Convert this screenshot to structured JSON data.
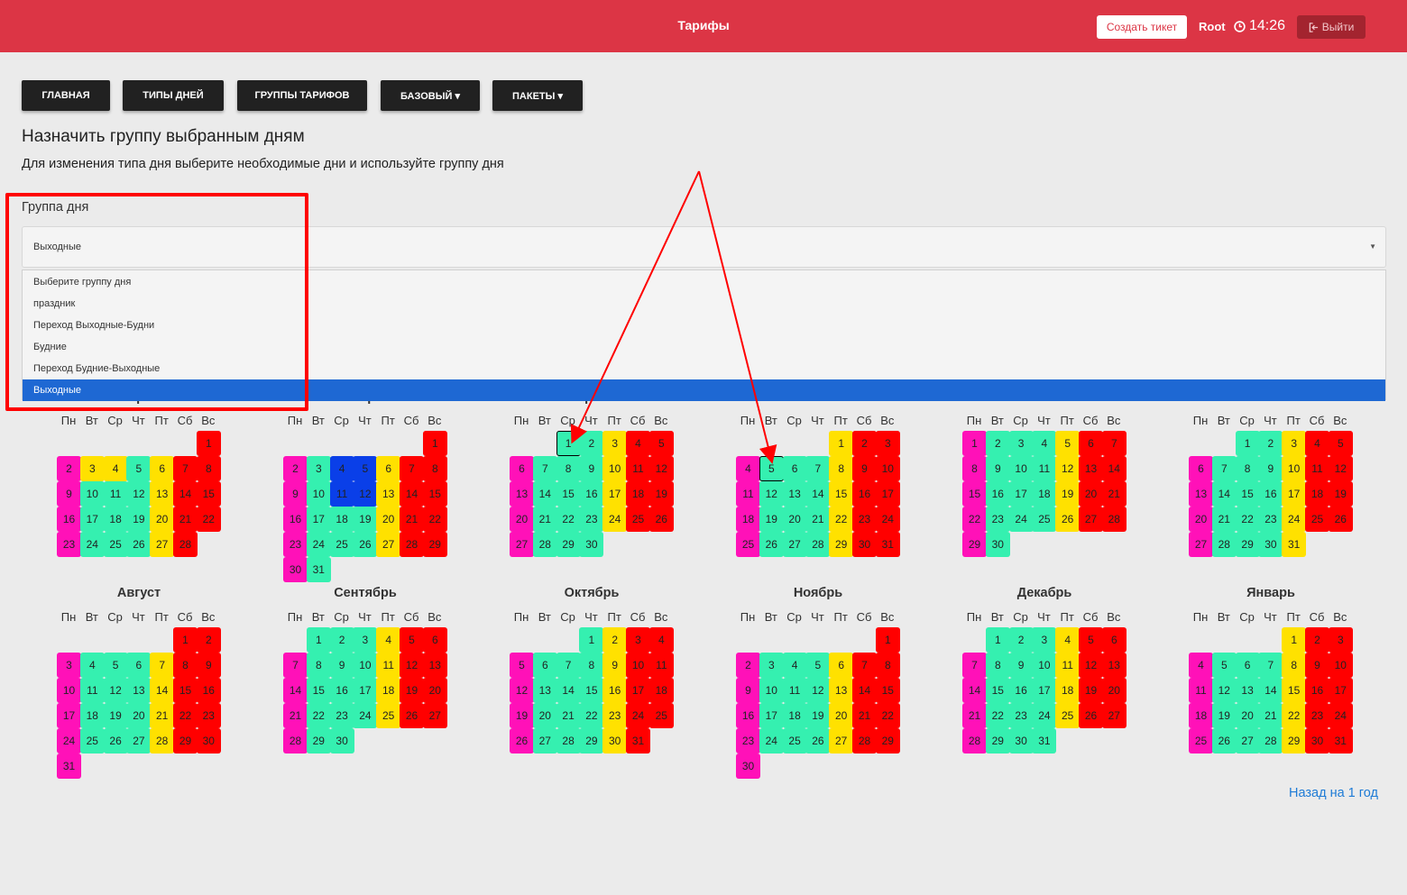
{
  "header": {
    "title": "Тарифы",
    "create_ticket": "Создать тикет",
    "user": "Root",
    "time": "14:26",
    "logout": "Выйти"
  },
  "nav": [
    {
      "label": "ГЛАВНАЯ"
    },
    {
      "label": "ТИПЫ ДНЕЙ"
    },
    {
      "label": "ГРУППЫ ТАРИФОВ"
    },
    {
      "label": "БАЗОВЫЙ ▾"
    },
    {
      "label": "ПАКЕТЫ ▾"
    }
  ],
  "page": {
    "heading": "Назначить группу выбранным дням",
    "subtitle": "Для изменения типа дня выберите необходимые дни и используйте группу дня",
    "back_link": "Назад на 1 год"
  },
  "group_select": {
    "label": "Группа дня",
    "value": "Выходные",
    "options": [
      "Выберите группу дня",
      "праздник",
      "Переход Выходные-Будни",
      "Будние",
      "Переход Будние-Выходные",
      "Выходные"
    ],
    "selected_index": 5
  },
  "weekdays": [
    "Пн",
    "Вт",
    "Ср",
    "Чт",
    "Пт",
    "Сб",
    "Вс"
  ],
  "colors": {
    "p": "#ff11b8",
    "g": "#35f0b0",
    "y": "#ffe100",
    "r": "#ff0000",
    "b": "#0a3fe8"
  },
  "months": [
    {
      "name": "Февраль",
      "start": 6,
      "days": 28,
      "colors": "rpyygyrrpggyrrpggyrrpggyrr",
      "colors_full": "rpyygyrrpggggyrrpggggyrrpggggyrr",
      "hidden_name": true
    },
    {
      "name": "Март",
      "start": 6,
      "days": 31,
      "colors": "rpgbbyrrpgbbyrrpggggyrrpggggyrrpg",
      "hidden_name": true
    },
    {
      "name": "Апрель",
      "start": 2,
      "days": 30,
      "colors": "ggyrrpggggyrrpggggyrrpggggyrrpggg",
      "hidden_name": true,
      "highlight": [
        1
      ]
    },
    {
      "name": "Май",
      "start": 4,
      "days": 31,
      "colors": "yrrpggggyrrpggggyrrpggggyrrpggggyrr",
      "hidden_name": true,
      "highlight": [
        5
      ]
    },
    {
      "name": "Июнь",
      "start": 0,
      "days": 30,
      "colors": "pgggyrrpggggyrrpggggyrrpggggyrrpg",
      "hidden_name": true
    },
    {
      "name": "Июль",
      "start": 2,
      "days": 31,
      "colors": "ggyrrpggggyrrpggggyrrpggggyrrpggy",
      "hidden_name": true
    },
    {
      "name": "Август",
      "start": 5,
      "days": 31,
      "colors": "rrpggggyrrpggggyrrpggggyrrpggggyrrp"
    },
    {
      "name": "Сентябрь",
      "start": 1,
      "days": 30,
      "colors": "gggyrrpggggyrrpggggyrrpggggyrrpgg"
    },
    {
      "name": "Октябрь",
      "start": 3,
      "days": 31,
      "colors": "gyrrpggggyrrpggggyrrpggggyrrpggggyr"
    },
    {
      "name": "Ноябрь",
      "start": 6,
      "days": 30,
      "colors": "rpggggyrrpggggyrrpggggyrrpggggyrrp"
    },
    {
      "name": "Декабрь",
      "start": 1,
      "days": 31,
      "colors": "gggyrrpggggyrrpggggyrrpggggyrrpggg"
    },
    {
      "name": "Январь",
      "start": 4,
      "days": 31,
      "colors": "yrrpggggyrrpggggyrrpggggyrrpggggyrr"
    }
  ]
}
